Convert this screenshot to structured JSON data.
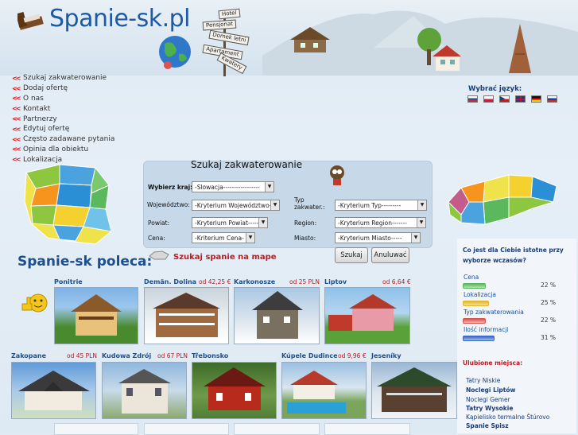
{
  "header": {
    "logo": "Spanie-sk.pl"
  },
  "signpost": [
    "Hotel",
    "Pensjonat",
    "Domek letni",
    "Apartament",
    "Kwatery"
  ],
  "menu": [
    "Szukaj zakwaterowanie",
    "Dodaj ofertę",
    "O nas",
    "Kontakt",
    "Partnerzy",
    "Edytuj ofertę",
    "Często zadawane pytania",
    "Opinia dla obiektu",
    "Lokalizacja"
  ],
  "search": {
    "title": "Szukaj zakwaterowanie",
    "country_label": "Wybierz kraj:",
    "country_value": "-Slowacja-----------------",
    "voivodeship_label": "Województwo:",
    "voivodeship_value": "-Kryterium Województwo-",
    "type_label_1": "Typ",
    "type_label_2": "zakwater.:",
    "type_value": "-Kryterium Typ---------",
    "county_label": "Powiat:",
    "county_value": "-Kryterium Powiat-----",
    "region_label": "Region:",
    "region_value": "-Kryterium Region-------",
    "price_label": "Cena:",
    "price_value": "-Kriterium Cena-",
    "city_label": "Miasto:",
    "city_value": "-Kryterium Miasto-----",
    "search_button": "Szukaj",
    "cancel_button": "Anuluwać",
    "map_link": "Szukaj spanie na mape"
  },
  "recommend_title": "Spanie-sk poleca:",
  "language": {
    "label": "Wybrać język:"
  },
  "survey": {
    "question": "Co jest dla Ciebie istotne przy wyborze wczasów?",
    "options": [
      {
        "label": "Cena",
        "percent": "22 %",
        "value": 0.22,
        "color": "#5cb85c"
      },
      {
        "label": "Lokalizacja",
        "percent": "25 %",
        "value": 0.25,
        "color": "#e0b82a"
      },
      {
        "label": "Typ zakwaterowania",
        "percent": "22 %",
        "value": 0.22,
        "color": "#d9534f"
      },
      {
        "label": "Ilość informacji",
        "percent": "31 %",
        "value": 0.31,
        "color": "#3a66c4"
      }
    ]
  },
  "favorites": {
    "title": "Ulubione miejsca:",
    "items": [
      "Tatry Niskie",
      "Noclegi Liptów",
      "Noclegi Gemer",
      "Tatry Wysokie",
      "Kąpielisko termalne Štúrovo",
      "Spanie Spisz"
    ]
  },
  "tiles_row1": [
    {
      "name": "Ponitrie",
      "price": ""
    },
    {
      "name": "Demän. Dolina",
      "price": "od 42,25 €"
    },
    {
      "name": "Karkonosze",
      "price": "od 25 PLN"
    },
    {
      "name": "Liptov",
      "price": "od 6,64 €"
    }
  ],
  "tiles_row2": [
    {
      "name": "Zakopane",
      "price": "od 45 PLN"
    },
    {
      "name": "Kudowa Zdrój",
      "price": "od 67 PLN"
    },
    {
      "name": "Třebonsko",
      "price": ""
    },
    {
      "name": "Kúpele Dudince",
      "price": "od 9,96 €"
    },
    {
      "name": "Jeseníky",
      "price": ""
    }
  ]
}
